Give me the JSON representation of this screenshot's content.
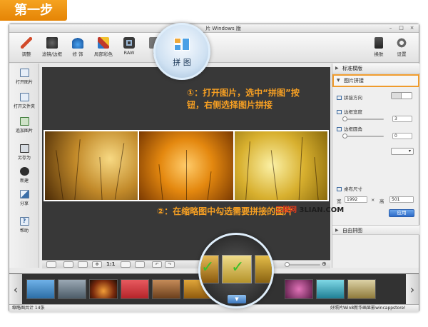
{
  "step_badge": "第一步",
  "window": {
    "title": "片 Windows 版",
    "controls": [
      "–",
      "□",
      "×"
    ]
  },
  "toolbar": {
    "tools": [
      {
        "label": "调整",
        "icon": "pencil-icon",
        "color": "#d24a2a"
      },
      {
        "label": "滤镜/边框",
        "icon": "filter-icon",
        "color": "#3e3e3e"
      },
      {
        "label": "修 饰",
        "icon": "drop-icon",
        "color": "#2c78c8"
      },
      {
        "label": "局部彩色",
        "icon": "brush-icon",
        "color": "#c0392b"
      },
      {
        "label": "RAW",
        "icon": "camera-icon",
        "color": "#3a3a3a"
      },
      {
        "label": "H",
        "icon": "hdr-icon",
        "color": "#3a3a3a"
      }
    ],
    "collage_label": "拼 图",
    "replace_label": "换肤",
    "settings_label": "设置"
  },
  "sidebar": {
    "items": [
      {
        "label": "打开图片",
        "icon": "open-image-icon"
      },
      {
        "label": "打开文件夹",
        "icon": "open-folder-icon"
      },
      {
        "label": "追加图片",
        "icon": "add-image-icon"
      },
      {
        "label": "另存为",
        "icon": "save-icon"
      },
      {
        "label": "新建",
        "icon": "new-icon"
      },
      {
        "label": "分享",
        "icon": "share-icon"
      },
      {
        "label": "帮助",
        "icon": "help-icon"
      }
    ]
  },
  "canvas_toolbar": {
    "zoom_label": "1:1"
  },
  "callouts": {
    "step1": "①：打开图片，选中“拼图”按钮，右侧选择图片拼接",
    "step2": "②：在缩略图中勾选需要拼接的图片"
  },
  "watermark": {
    "prefix": "三联网",
    "suffix": " 3LIAN.COM"
  },
  "right_panel": {
    "section_standard": "标准模版",
    "section_collage": "图片拼接",
    "direction_label": "拼接方向",
    "border_width_label": "边框宽度",
    "border_width_value": "3",
    "border_radius_label": "边框圆角",
    "border_radius_value": "0",
    "canvas_size_label": "桌布尺寸",
    "width_label": "宽",
    "width_value": "1992",
    "height_label": "高",
    "height_value": "501",
    "apply_label": "应用",
    "free_collage_label": "自由拼图"
  },
  "thumbnails": {
    "colors": [
      "#3f7fb4",
      "#5a6c7a",
      "#b0401f",
      "#d43f45",
      "#8a5a2e",
      "#c98a1a",
      "#d9c15a",
      "#b34b8f",
      "#2da2b8"
    ]
  },
  "status": {
    "count_text": "缩略图共计 14张",
    "news_text": "好照片Win8新华画显影wincappstore!"
  }
}
